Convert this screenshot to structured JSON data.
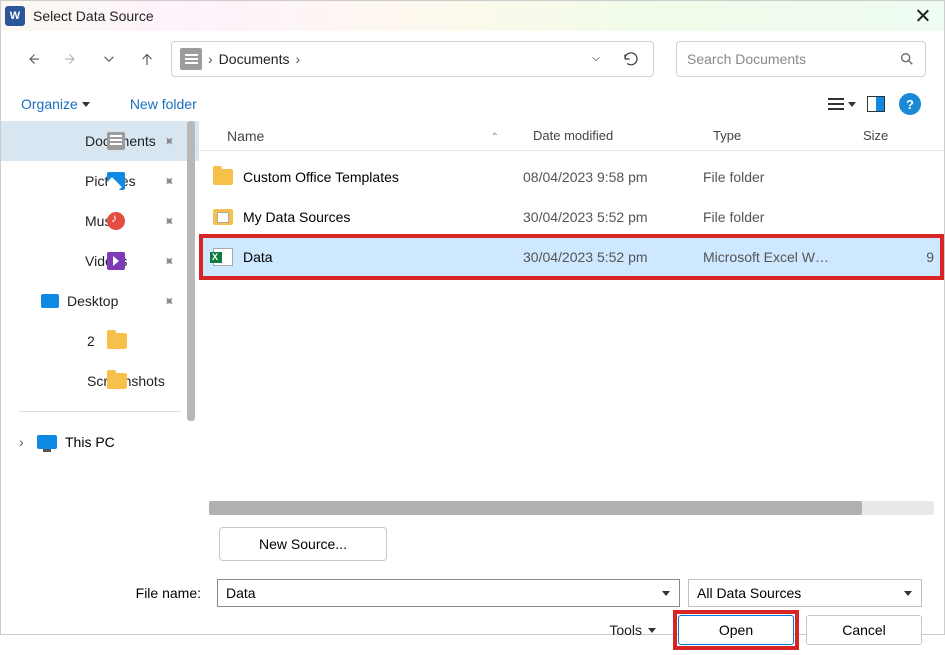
{
  "title": "Select Data Source",
  "breadcrumb": {
    "location": "Documents"
  },
  "search": {
    "placeholder": "Search Documents"
  },
  "toolbar": {
    "organize": "Organize",
    "newfolder": "New folder"
  },
  "sidebar": {
    "items": [
      {
        "label": "Documents",
        "active": true
      },
      {
        "label": "Pictures"
      },
      {
        "label": "Music"
      },
      {
        "label": "Videos"
      },
      {
        "label": "Desktop"
      },
      {
        "label": "2"
      },
      {
        "label": "Screenshots"
      }
    ],
    "thispc": "This PC"
  },
  "columns": {
    "name": "Name",
    "date": "Date modified",
    "type": "Type",
    "size": "Size"
  },
  "files": [
    {
      "name": "Custom Office Templates",
      "date": "08/04/2023 9:58 pm",
      "type": "File folder",
      "size": "",
      "icon": "folder"
    },
    {
      "name": "My Data Sources",
      "date": "30/04/2023 5:52 pm",
      "type": "File folder",
      "size": "",
      "icon": "mds"
    },
    {
      "name": "Data",
      "date": "30/04/2023 5:52 pm",
      "type": "Microsoft Excel W…",
      "size": "9",
      "icon": "excel",
      "selected": true
    }
  ],
  "footer": {
    "newsource": "New Source...",
    "filename_label": "File name:",
    "filename_value": "Data",
    "filter": "All Data Sources",
    "tools": "Tools",
    "open": "Open",
    "cancel": "Cancel"
  }
}
